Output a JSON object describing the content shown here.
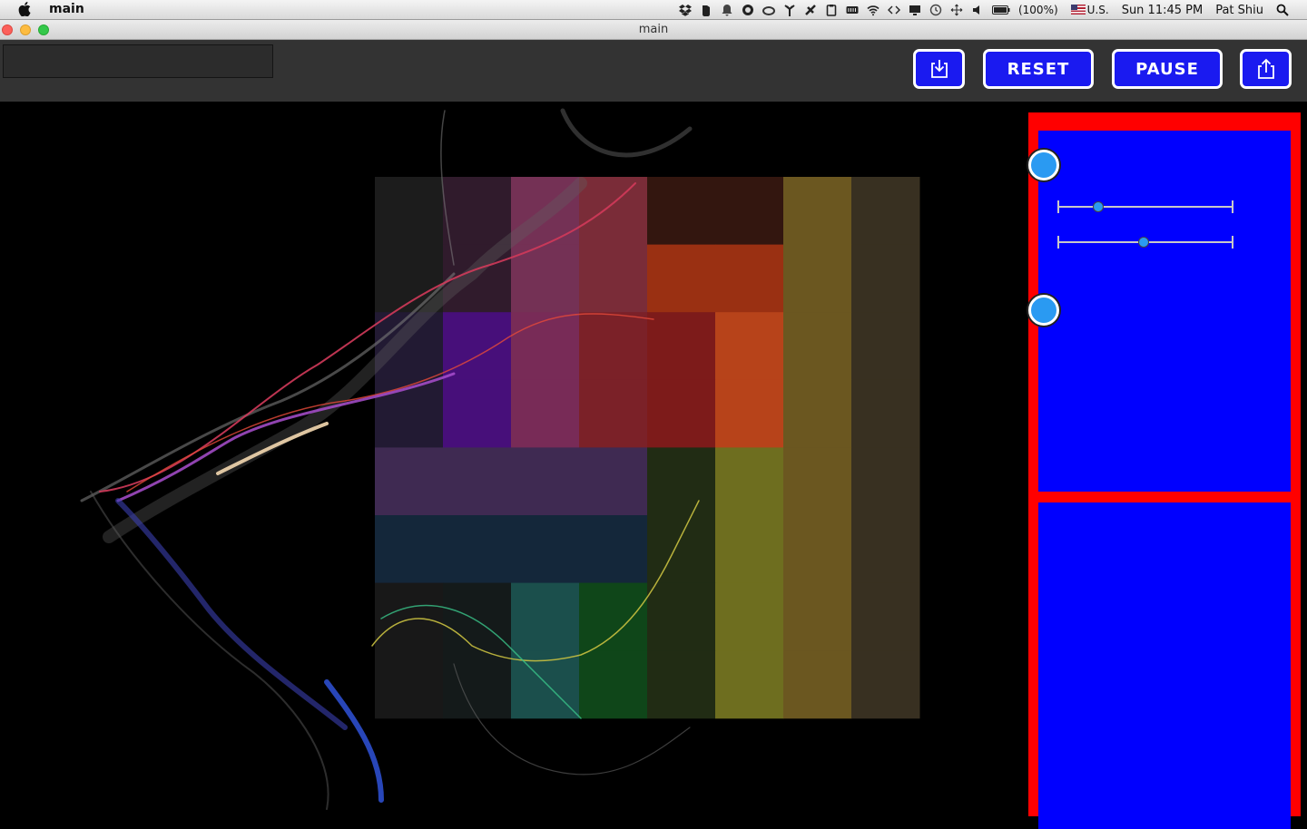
{
  "menubar": {
    "app_name": "main",
    "battery": "(100%)",
    "input_source": "U.S.",
    "clock": "Sun 11:45 PM",
    "user": "Pat Shiu",
    "status_icons": [
      "dropbox-icon",
      "evernote-icon",
      "notification-bell-icon",
      "record-icon",
      "creative-cloud-icon",
      "airdrop-icon",
      "gpu-icon",
      "clipboard-icon",
      "memory-icon",
      "wifi-icon",
      "code-icon",
      "display-icon",
      "time-machine-icon",
      "move-icon",
      "volume-icon",
      "battery-icon"
    ]
  },
  "window": {
    "title": "main"
  },
  "toolbar": {
    "text_value": "",
    "reset_label": "RESET",
    "pause_label": "PAUSE",
    "import_icon": "download-tray-icon",
    "export_icon": "share-icon"
  },
  "controls": {
    "slider1_value": 0.23,
    "slider2_value": 0.49
  },
  "colors": {
    "accent_blue": "#1a1af0",
    "panel_red": "#ff0000",
    "panel_blue": "#0000ff",
    "knob": "#2a9af2",
    "toolbar": "#333333"
  },
  "color_grid": [
    [
      "#1c1c1c",
      "#301b2c",
      "#743155",
      "#7a2c38",
      "#33160f",
      "#33160f",
      "#6b5720",
      "#383021"
    ],
    [
      "#1c1c1c",
      "#301b2c",
      "#743155",
      "#7a2c38",
      "#9a3012",
      "#9a3012",
      "#6b5720",
      "#383021"
    ],
    [
      "#221a33",
      "#470f7a",
      "#782b57",
      "#7b2128",
      "#7d1b1a",
      "#b7431a",
      "#6b5720",
      "#383021"
    ],
    [
      "#221a33",
      "#470f7a",
      "#782b57",
      "#7b2128",
      "#7d1b1a",
      "#b7431a",
      "#6b5720",
      "#383021"
    ],
    [
      "#3f2a52",
      "#3f2a52",
      "#3f2a52",
      "#3f2a52",
      "#212c14",
      "#6e6e1f",
      "#6b5720",
      "#383021"
    ],
    [
      "#14273a",
      "#14273a",
      "#14273a",
      "#14273a",
      "#212c14",
      "#6e6e1f",
      "#6b5720",
      "#383021"
    ],
    [
      "#181818",
      "#141a1a",
      "#1b4f4c",
      "#0f4619",
      "#212c14",
      "#6e6e1f",
      "#6b5720",
      "#383021"
    ],
    [
      "#181818",
      "#141a1a",
      "#1b4f4c",
      "#0f4619",
      "#212c14",
      "#6e6e1f",
      "#6b5720",
      "#383021"
    ]
  ]
}
